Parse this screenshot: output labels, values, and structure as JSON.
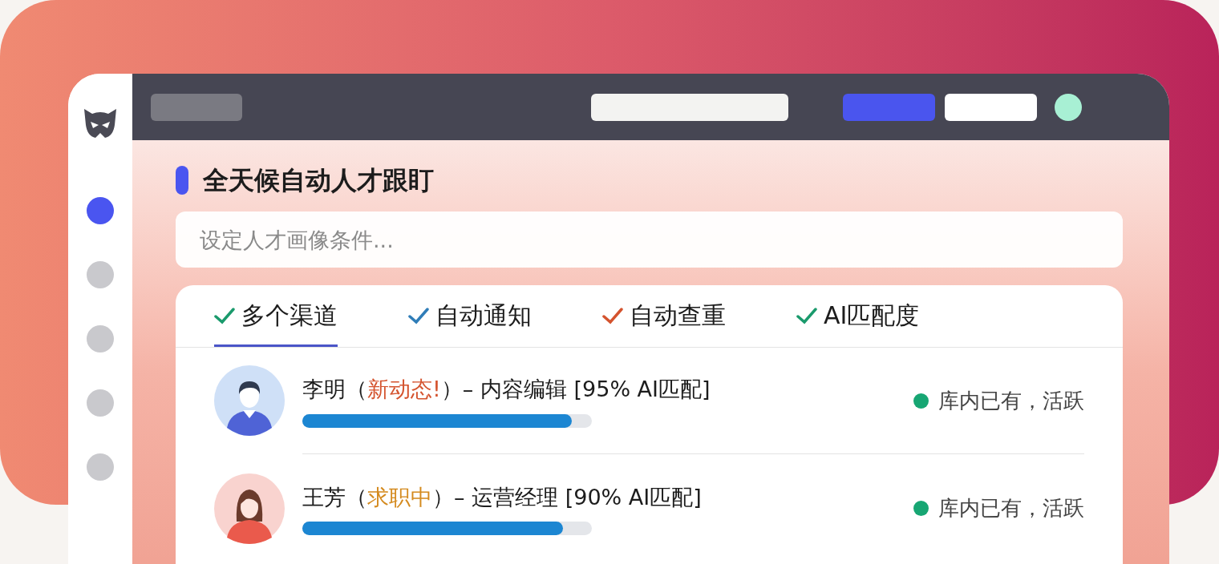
{
  "sidebar": {
    "items": [
      {
        "selected": true
      },
      {
        "selected": false
      },
      {
        "selected": false
      },
      {
        "selected": false
      },
      {
        "selected": false
      }
    ]
  },
  "heading": "全天候自动人才跟盯",
  "search": {
    "placeholder": "设定人才画像条件..."
  },
  "tabs": [
    {
      "label": "多个渠道",
      "color": "#1a9a6c",
      "selected": true
    },
    {
      "label": "自动通知",
      "color": "#2f7db8",
      "selected": false
    },
    {
      "label": "自动查重",
      "color": "#d4532e",
      "selected": false
    },
    {
      "label": "AI匹配度",
      "color": "#1a9a6c",
      "selected": false
    }
  ],
  "candidates": [
    {
      "kind": "male",
      "title_before": "李明（",
      "highlight": {
        "text": "新动态!",
        "color": "#d4532e"
      },
      "title_after": "）– 内容编辑 [95% AI匹配]",
      "level": 0.93,
      "status": {
        "text": "库内已有，活跃",
        "color": "#17a673"
      }
    },
    {
      "kind": "female",
      "title_before": "王芳（",
      "highlight": {
        "text": "求职中",
        "color": "#d48a1e"
      },
      "title_after": "）– 运营经理 [90% AI匹配]",
      "level": 0.9,
      "status": {
        "text": "库内已有，活跃",
        "color": "#17a673"
      }
    }
  ]
}
